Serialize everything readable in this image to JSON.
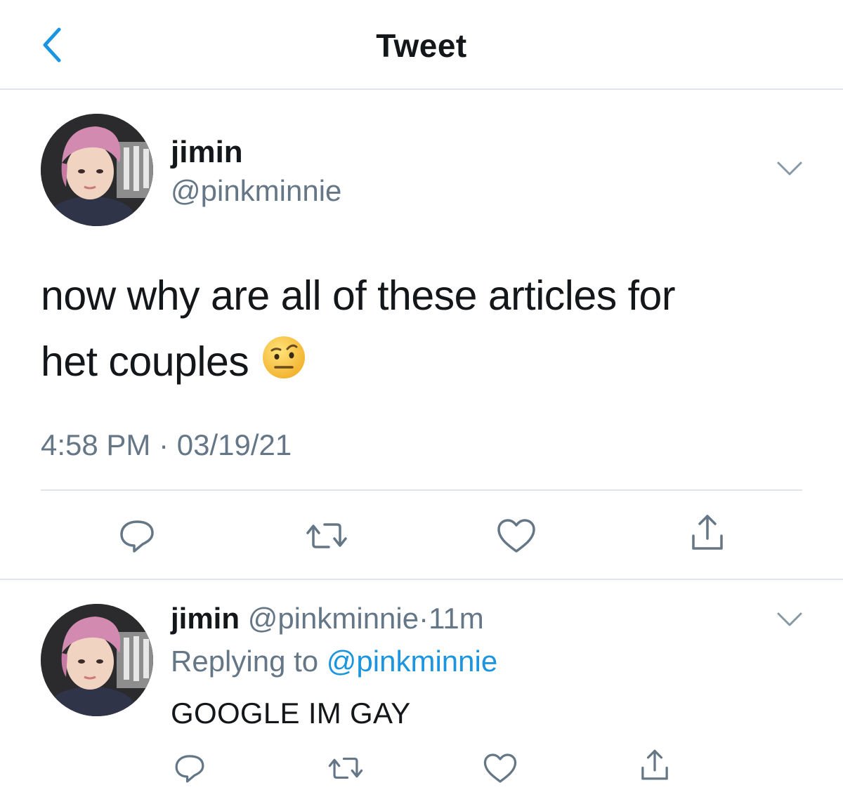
{
  "header": {
    "title": "Tweet",
    "back_icon": "chevron-left-icon"
  },
  "colors": {
    "accent": "#1b95e0",
    "muted": "#657786",
    "text": "#14171a",
    "divider": "#e1e4e8"
  },
  "tweet": {
    "author_name": "jimin",
    "author_handle": "@pinkminnie",
    "text_line1": "now why are all of these articles for",
    "text_line2": "het couples",
    "emoji": "face-with-raised-eyebrow-icon",
    "timestamp": "4:58 PM · 03/19/21",
    "actions": [
      "reply-icon",
      "retweet-icon",
      "like-icon",
      "share-icon"
    ]
  },
  "reply": {
    "author_name": "jimin",
    "author_handle": "@pinkminnie",
    "separator": "·",
    "age": "11m",
    "replying_prefix": "Replying to",
    "replying_handle": "@pinkminnie",
    "text": "GOOGLE IM GAY",
    "actions": [
      "reply-icon",
      "retweet-icon",
      "like-icon",
      "share-icon"
    ]
  }
}
